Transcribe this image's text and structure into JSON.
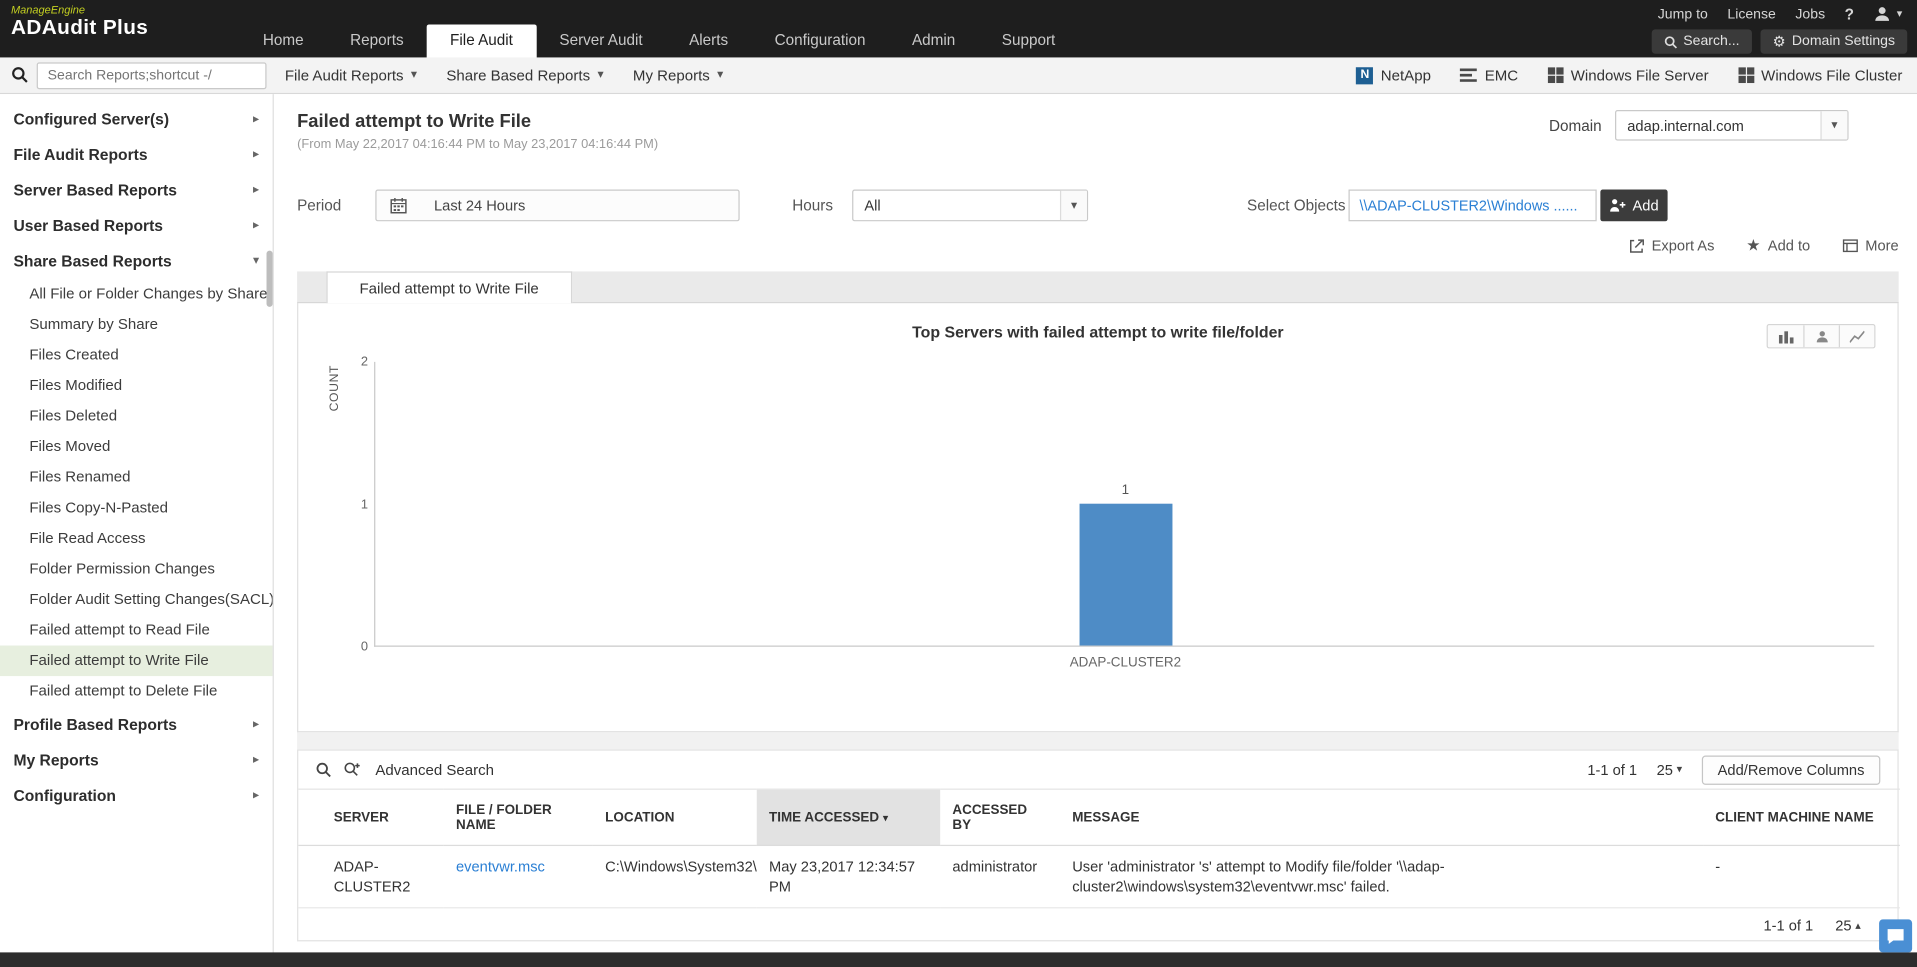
{
  "icons": {
    "gear": "⚙",
    "star": "★",
    "caret_down": "▾",
    "caret_up": "▴",
    "caret_right": "▸"
  },
  "header": {
    "logo_manageengine": "ManageEngine",
    "logo_product": "ADAudit Plus",
    "top_links": [
      "Jump to",
      "License",
      "Jobs"
    ],
    "help_icon": "?",
    "nav_tabs": [
      {
        "label": "Home",
        "active": false
      },
      {
        "label": "Reports",
        "active": false
      },
      {
        "label": "File Audit",
        "active": true
      },
      {
        "label": "Server Audit",
        "active": false
      },
      {
        "label": "Alerts",
        "active": false
      },
      {
        "label": "Configuration",
        "active": false
      },
      {
        "label": "Admin",
        "active": false
      },
      {
        "label": "Support",
        "active": false
      }
    ],
    "search_button": "Search...",
    "domain_settings_button": "Domain Settings"
  },
  "toolbar": {
    "search_placeholder": "Search Reports;shortcut -/",
    "menus": [
      "File Audit Reports",
      "Share Based Reports",
      "My Reports"
    ],
    "server_types": [
      "NetApp",
      "EMC",
      "Windows File Server",
      "Windows File Cluster"
    ]
  },
  "sidebar": {
    "sections": [
      {
        "label": "Configured Server(s)",
        "expanded": false
      },
      {
        "label": "File Audit Reports",
        "expanded": false
      },
      {
        "label": "Server Based Reports",
        "expanded": false
      },
      {
        "label": "User Based Reports",
        "expanded": false
      },
      {
        "label": "Share Based Reports",
        "expanded": true,
        "selected_item": "Failed attempt to Write File",
        "items": [
          "All File or Folder Changes by Share",
          "Summary by Share",
          "Files Created",
          "Files Modified",
          "Files Deleted",
          "Files Moved",
          "Files Renamed",
          "Files Copy-N-Pasted",
          "File Read Access",
          "Folder Permission Changes",
          "Folder Audit Setting Changes(SACL)",
          "Failed attempt to Read File",
          "Failed attempt to Write File",
          "Failed attempt to Delete File"
        ]
      },
      {
        "label": "Profile Based Reports",
        "expanded": false
      },
      {
        "label": "My Reports",
        "expanded": false
      },
      {
        "label": "Configuration",
        "expanded": false
      }
    ]
  },
  "page": {
    "title": "Failed attempt to Write File",
    "subtitle": "(From May 22,2017 04:16:44 PM to May 23,2017 04:16:44 PM)",
    "domain_label": "Domain",
    "domain_value": "adap.internal.com",
    "period_label": "Period",
    "period_value": "Last 24 Hours",
    "hours_label": "Hours",
    "hours_value": "All",
    "select_objects_label": "Select Objects",
    "select_objects_value": "\\\\ADAP-CLUSTER2\\Windows ......",
    "add_button": "Add",
    "actions": [
      "Export As",
      "Add to",
      "More"
    ],
    "tab": "Failed attempt to Write File"
  },
  "chart_data": {
    "type": "bar",
    "title": "Top Servers with failed attempt to write file/folder",
    "categories": [
      "ADAP-CLUSTER2"
    ],
    "values": [
      1
    ],
    "xlabel": "",
    "ylabel": "COUNT",
    "ylim": [
      0,
      2
    ],
    "yticks": [
      0,
      1,
      2
    ],
    "grid": false,
    "legend": "none",
    "bar_color": "#4e8cc6"
  },
  "table": {
    "advanced_search": "Advanced Search",
    "add_remove_columns": "Add/Remove Columns",
    "pagination_top": {
      "range": "1-1 of 1",
      "page_size": "25"
    },
    "pagination_bottom": {
      "range": "1-1 of 1",
      "page_size": "25"
    },
    "columns": [
      "SERVER",
      "FILE / FOLDER NAME",
      "LOCATION",
      "TIME ACCESSED",
      "ACCESSED BY",
      "MESSAGE",
      "CLIENT MACHINE NAME"
    ],
    "sorted_column": "TIME ACCESSED",
    "rows": [
      {
        "server": "ADAP-CLUSTER2",
        "file_folder_name": "eventvwr.msc",
        "location": "C:\\Windows\\System32\\",
        "time_accessed": "May 23,2017 12:34:57 PM",
        "accessed_by": "administrator",
        "message": "User 'administrator 's' attempt to Modify file/folder '\\\\adap-cluster2\\windows\\system32\\eventvwr.msc' failed.",
        "client_machine_name": "-"
      }
    ]
  }
}
